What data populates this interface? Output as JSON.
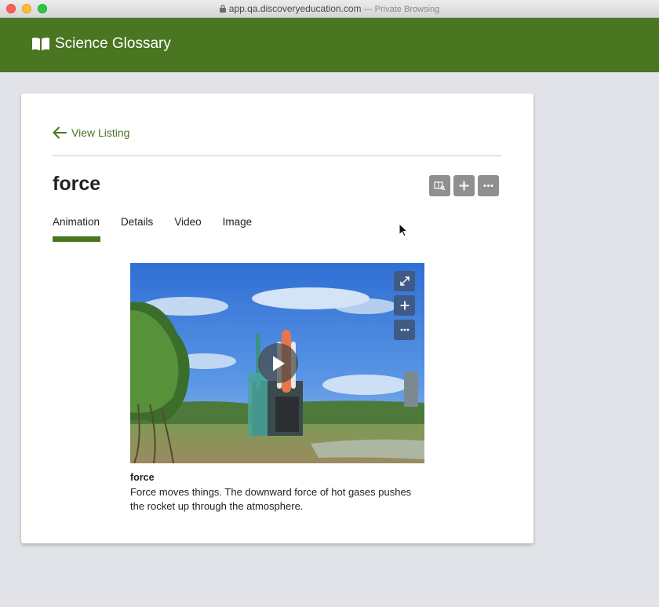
{
  "browser": {
    "url": "app.qa.discoveryeducation.com",
    "mode": " — Private Browsing"
  },
  "header": {
    "title": "Science Glossary",
    "icon": "book-open-icon",
    "bg_color": "#4a7521"
  },
  "card": {
    "back_label": "View Listing",
    "term": "force",
    "actions": [
      "dictionary-icon",
      "plus-icon",
      "more-icon"
    ],
    "tabs": [
      {
        "label": "Animation",
        "active": true
      },
      {
        "label": "Details",
        "active": false
      },
      {
        "label": "Video",
        "active": false
      },
      {
        "label": "Image",
        "active": false
      }
    ],
    "media": {
      "controls": [
        "expand-icon",
        "plus-icon",
        "more-icon"
      ],
      "play_icon": "play-icon"
    },
    "caption": {
      "title": "force",
      "text": "Force moves things. The downward force of hot gases pushes the rocket up through the atmosphere."
    }
  }
}
